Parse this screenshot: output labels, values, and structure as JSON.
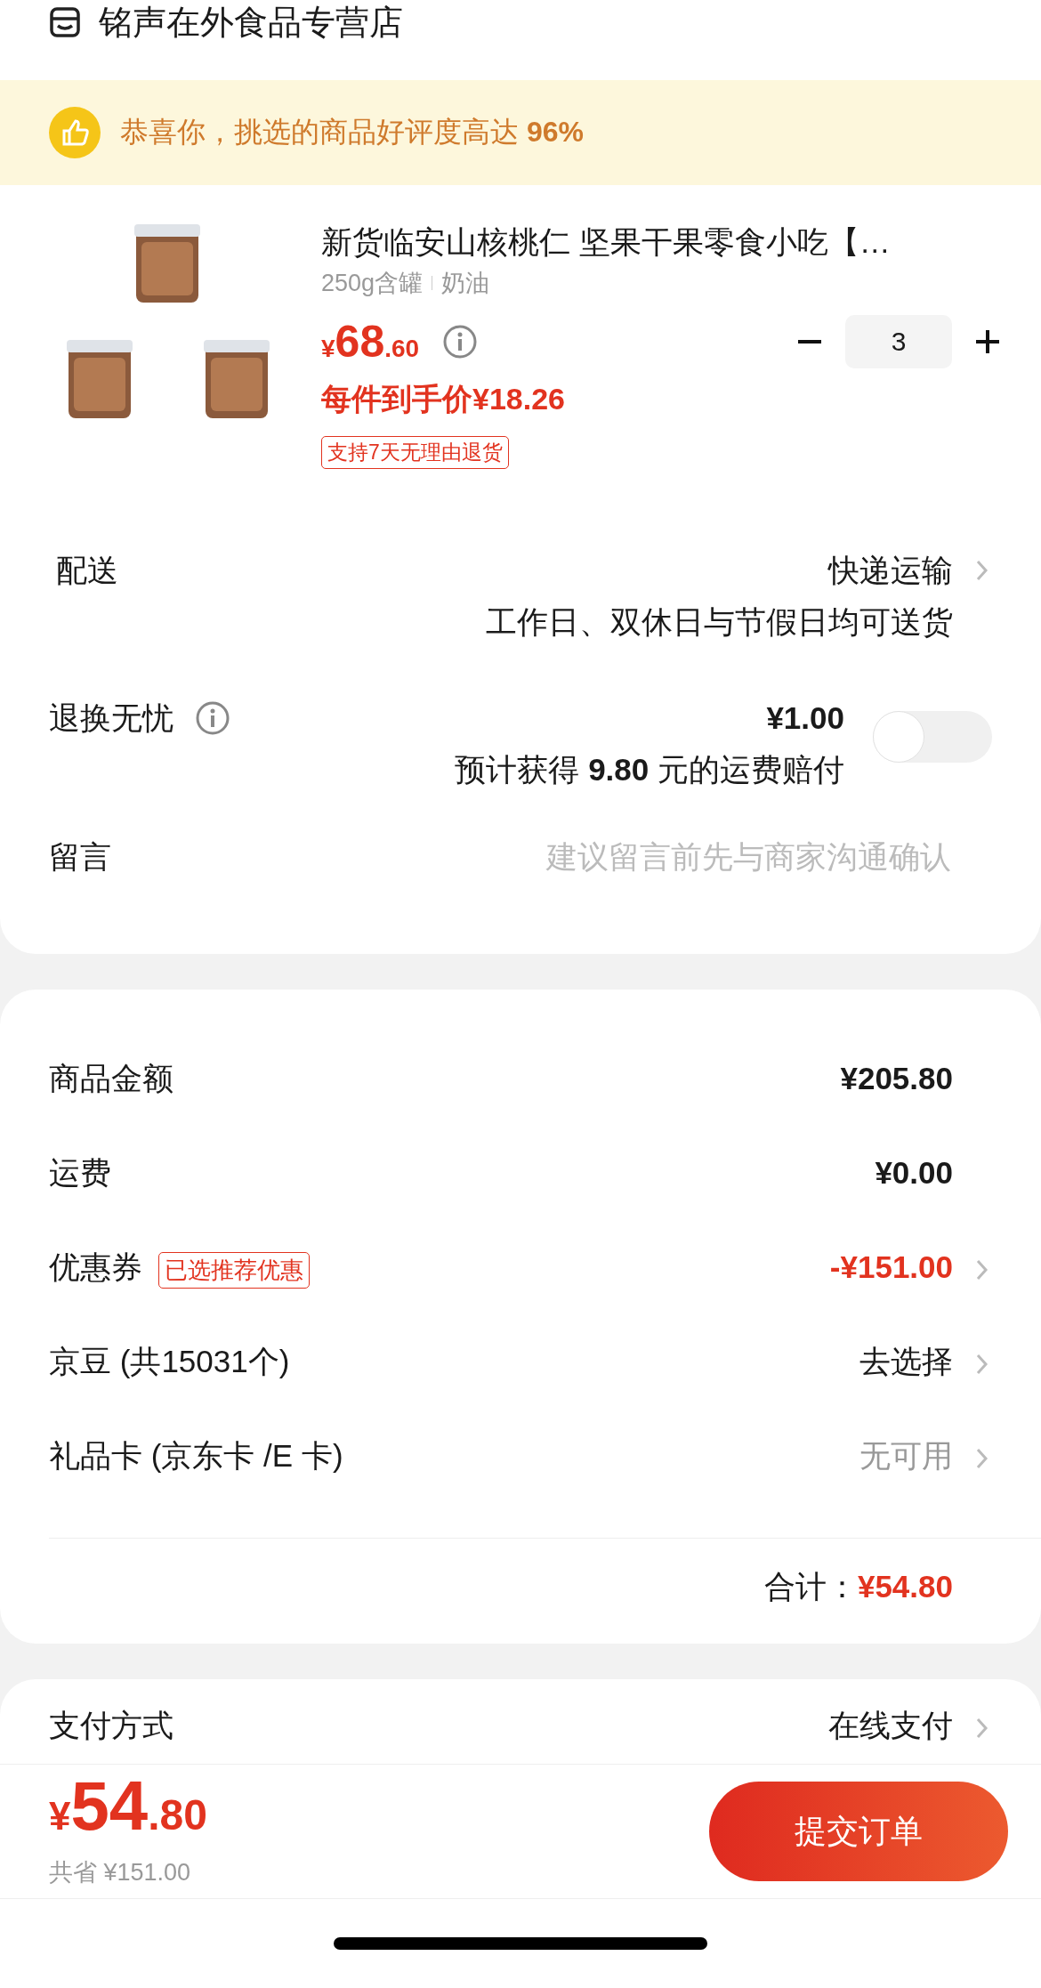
{
  "store": {
    "name": "铭声在外食品专营店"
  },
  "banner": {
    "text": "恭喜你，挑选的商品好评度高达 **96%**"
  },
  "product": {
    "title": "新货临安山核桃仁  坚果干果零食小吃【…",
    "specs": [
      "250g含罐",
      "奶油"
    ],
    "price": {
      "currency": "¥",
      "integer": "68",
      "decimal": ".60"
    },
    "unit_price": "每件到手价¥18.26",
    "quantity": "3",
    "tag": "支持7天无理由退货"
  },
  "delivery": {
    "label": "配送",
    "value": "快递运输",
    "note": "工作日、双休日与节假日均可送货"
  },
  "return_insurance": {
    "label": "退换无忧",
    "price": "¥1.00",
    "note": "预计获得 **9.80** 元的运费赔付",
    "on": false
  },
  "message": {
    "label": "留言",
    "placeholder": "建议留言前先与商家沟通确认"
  },
  "summary": {
    "rows": [
      {
        "kind": "amount",
        "label": "商品金额",
        "value": "¥205.80"
      },
      {
        "kind": "amount",
        "label": "运费",
        "value": "¥0.00"
      },
      {
        "kind": "discount",
        "label": "优惠券",
        "badge": "已选推荐优惠",
        "value": "-¥151.00"
      },
      {
        "kind": "link",
        "label": "京豆 (共15031个)",
        "value": "去选择"
      },
      {
        "kind": "unavailable",
        "label": "礼品卡 (京东卡 /E 卡)",
        "value": "无可用"
      }
    ],
    "total_label": "合计：",
    "total": "¥54.80"
  },
  "payment": {
    "label": "支付方式",
    "value": "在线支付"
  },
  "footer": {
    "currency": "¥",
    "integer": "54",
    "decimal": ".80",
    "savings": "共省 ¥151.00",
    "submit": "提交订单"
  }
}
